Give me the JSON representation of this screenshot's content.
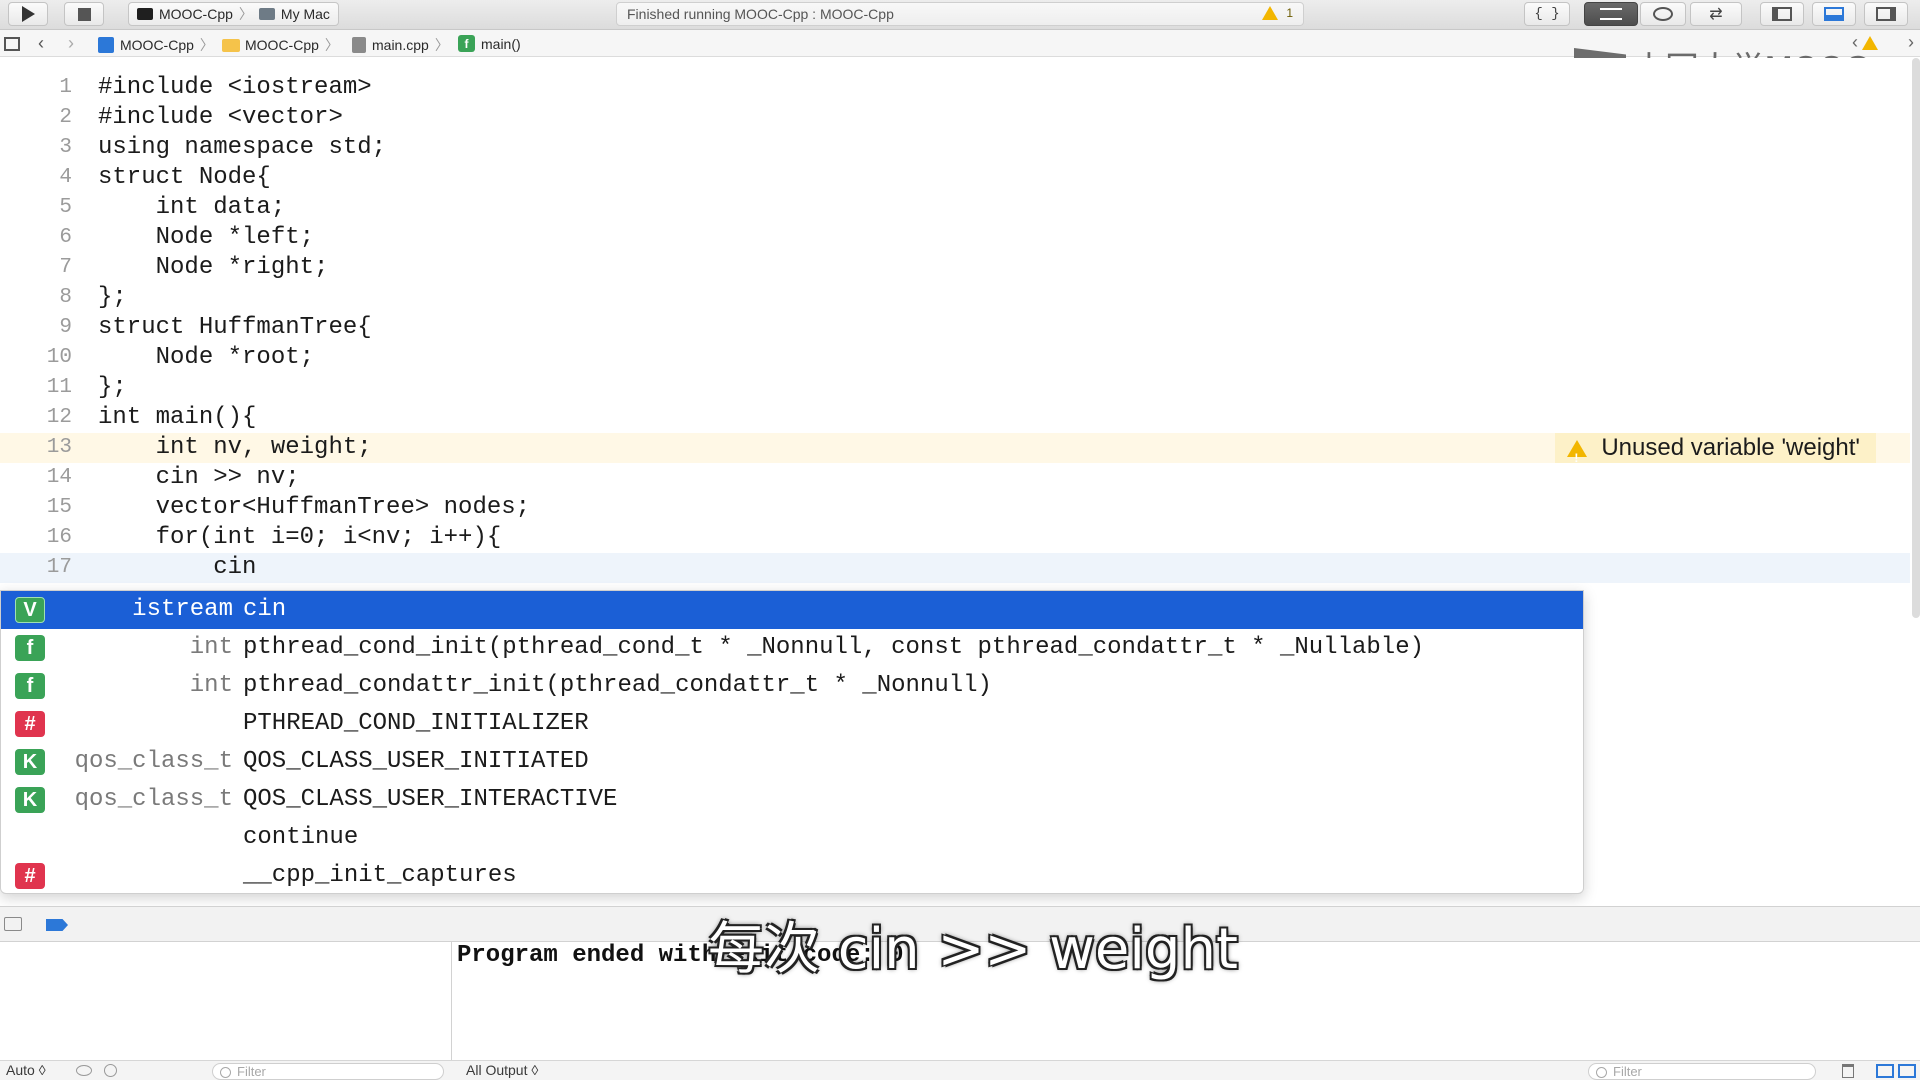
{
  "toolbar": {
    "scheme_target": "MOOC-Cpp",
    "scheme_device": "My Mac",
    "activity_text": "Finished running MOOC-Cpp : MOOC-Cpp",
    "warning_count": "1",
    "braces_label": "{ }"
  },
  "jumpbar": {
    "crumbs": [
      "MOOC-Cpp",
      "MOOC-Cpp",
      "main.cpp",
      "main()"
    ]
  },
  "watermark": {
    "text": "中国大学MOOC"
  },
  "editor": {
    "lines": [
      {
        "n": "1",
        "text": "#include <iostream>"
      },
      {
        "n": "2",
        "text": "#include <vector>"
      },
      {
        "n": "3",
        "text": "using namespace std;"
      },
      {
        "n": "4",
        "text": "struct Node{"
      },
      {
        "n": "5",
        "text": "    int data;"
      },
      {
        "n": "6",
        "text": "    Node *left;"
      },
      {
        "n": "7",
        "text": "    Node *right;"
      },
      {
        "n": "8",
        "text": "};"
      },
      {
        "n": "9",
        "text": "struct HuffmanTree{"
      },
      {
        "n": "10",
        "text": "    Node *root;"
      },
      {
        "n": "11",
        "text": "};"
      },
      {
        "n": "12",
        "text": "int main(){"
      },
      {
        "n": "13",
        "text": "    int nv, weight;"
      },
      {
        "n": "14",
        "text": "    cin >> nv;"
      },
      {
        "n": "15",
        "text": "    vector<HuffmanTree> nodes;"
      },
      {
        "n": "16",
        "text": "    for(int i=0; i<nv; i++){"
      },
      {
        "n": "17",
        "text": "        cin"
      }
    ],
    "warning_message": "Unused variable 'weight'"
  },
  "completion": {
    "items": [
      {
        "badge": "V",
        "ret": "istream",
        "name": "cin"
      },
      {
        "badge": "f",
        "ret": "int",
        "name": "pthread_cond_init(pthread_cond_t * _Nonnull, const pthread_condattr_t * _Nullable)"
      },
      {
        "badge": "f",
        "ret": "int",
        "name": "pthread_condattr_init(pthread_condattr_t * _Nonnull)"
      },
      {
        "badge": "#",
        "ret": "",
        "name": "PTHREAD_COND_INITIALIZER"
      },
      {
        "badge": "K",
        "ret": "qos_class_t",
        "name": "QOS_CLASS_USER_INITIATED"
      },
      {
        "badge": "K",
        "ret": "qos_class_t",
        "name": "QOS_CLASS_USER_INTERACTIVE"
      },
      {
        "badge": "",
        "ret": "",
        "name": "continue"
      },
      {
        "badge": "#",
        "ret": "",
        "name": "__cpp_init_captures"
      }
    ]
  },
  "console": {
    "output": "Program ended with exit code: 0",
    "subtitle": "每次 cin >> weight"
  },
  "bottombar": {
    "auto_label": "Auto ◊",
    "filter_placeholder": "Filter",
    "output_selector": "All Output ◊"
  },
  "colors": {
    "selection": "#1b5fd6",
    "keyword": "#b03b8f",
    "type": "#3d8fa3",
    "warning": "#f2b600"
  }
}
